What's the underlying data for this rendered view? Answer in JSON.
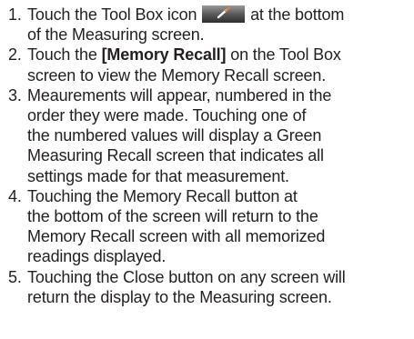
{
  "steps": [
    {
      "number": "1.",
      "line1_before": "Touch the Tool Box icon",
      "icon": "tool-box-icon",
      "line1_after": "at the bottom",
      "line2": "of the Measuring screen."
    },
    {
      "number": "2.",
      "line1_before": "Touch the",
      "line1_bold": "[Memory Recall]",
      "line1_after": "on the Tool Box",
      "line2": "screen to view the Memory Recall screen."
    },
    {
      "number": "3.",
      "lines": [
        "Meaurements will appear, numbered in the",
        "order they were made. Touching one of",
        "the numbered values will display a Green",
        "Measuring Recall screen that indicates all",
        "settings made for that measurement."
      ]
    },
    {
      "number": "4.",
      "lines": [
        "Touching the Memory Recall button at",
        "the bottom of the screen will return to the",
        "Memory Recall screen with all memorized",
        "readings displayed."
      ]
    },
    {
      "number": "5.",
      "lines": [
        "Touching the Close button on any screen will",
        "return the display to the Measuring screen."
      ]
    }
  ],
  "colors": {
    "text": "#231f20",
    "icon_dark": "#3c3c3c",
    "icon_light": "#8a8a8a",
    "icon_accent": "#e8862a"
  }
}
